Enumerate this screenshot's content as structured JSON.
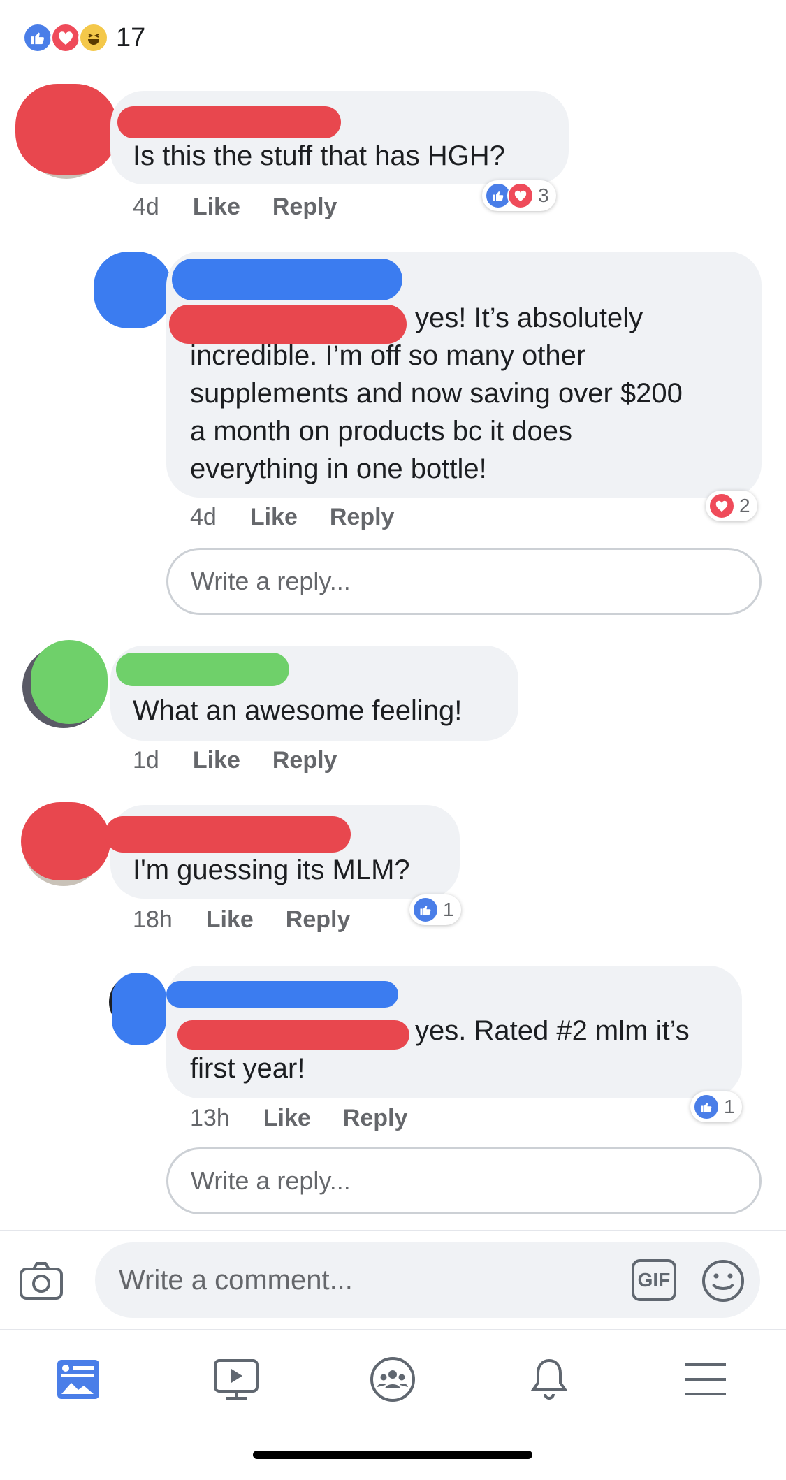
{
  "top_reactions": {
    "count": "17",
    "icons": [
      "like-icon",
      "love-icon",
      "haha-icon"
    ]
  },
  "comments": [
    {
      "text": "Is this the stuff that has HGH?",
      "time": "4d",
      "like_label": "Like",
      "reply_label": "Reply",
      "reaction_count": "3"
    },
    {
      "text_line1": "yes! It’s absolutely",
      "text_rest": [
        "incredible. I’m off so many other",
        "supplements and now saving over $200",
        "a month on products bc it does",
        "everything in one bottle!"
      ],
      "time": "4d",
      "like_label": "Like",
      "reply_label": "Reply",
      "reaction_count": "2"
    },
    {
      "text": "What an awesome feeling!",
      "time": "1d",
      "like_label": "Like",
      "reply_label": "Reply"
    },
    {
      "text": "I'm guessing its MLM?",
      "time": "18h",
      "like_label": "Like",
      "reply_label": "Reply",
      "reaction_count": "1"
    },
    {
      "text_line1": "yes. Rated #2 mlm it’s",
      "text_rest": [
        "first year!"
      ],
      "time": "13h",
      "like_label": "Like",
      "reply_label": "Reply",
      "reaction_count": "1"
    }
  ],
  "reply_placeholder": "Write a reply...",
  "composer": {
    "placeholder": "Write a comment...",
    "gif_label": "GIF"
  },
  "tabs": [
    "news-feed-icon",
    "watch-icon",
    "groups-icon",
    "notifications-icon",
    "menu-icon"
  ],
  "colors": {
    "like": "#4a7ee8",
    "love": "#ef4b5a",
    "haha": "#f4c84a",
    "bubble": "#f0f2f5",
    "red_scribble": "#e8474e",
    "blue_scribble": "#3b7cf0",
    "green_scribble": "#6fd06a"
  }
}
